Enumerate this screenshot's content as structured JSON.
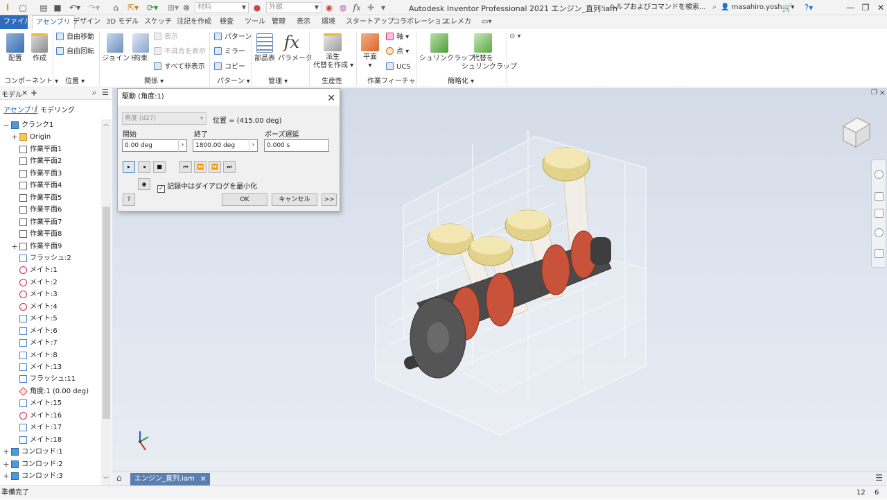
{
  "app": {
    "title": "Autodesk Inventor Professional 2021   エンジン_直列.iam",
    "material_placeholder": "材料",
    "appearance_placeholder": "外観",
    "help_search": "ヘルプおよびコマンドを検索...",
    "user": "masahiro.yosh..."
  },
  "tabs": [
    "ファイル",
    "アセンブリ",
    "デザイン",
    "3D モデル",
    "スケッチ",
    "注記を作成",
    "検査",
    "ツール",
    "管理",
    "表示",
    "環境",
    "スタートアップ",
    "コラボレーション",
    "エレメカ"
  ],
  "active_tab": "アセンブリ",
  "ribbon": {
    "component": {
      "place": "配置",
      "create": "作成",
      "group": "コンポーネント"
    },
    "position": {
      "free_move": "自由移動",
      "free_rotate": "自由回転",
      "group": "位置"
    },
    "relations": {
      "joint": "ジョイント",
      "constrain": "拘束",
      "show": "表示",
      "show_problem": "不具合を表示",
      "hide_all": "すべて非表示",
      "group": "関係"
    },
    "pattern": {
      "pattern": "パターン",
      "mirror": "ミラー",
      "copy": "コピー",
      "group": "パターン"
    },
    "manage": {
      "bom": "部品表",
      "params": "パラメータ",
      "group": "管理"
    },
    "productivity": {
      "derive_l1": "派生",
      "derive_l2": "代替を作成",
      "group": "生産性"
    },
    "work": {
      "plane": "平面",
      "axis": "軸",
      "point": "点",
      "ucs": "UCS",
      "group": "作業フィーチャ"
    },
    "simplify": {
      "shrinkwrap": "シュリンクラップ",
      "sub_l1": "代替を",
      "sub_l2": "シュリンクラップ",
      "group": "簡略化"
    }
  },
  "browser": {
    "title": "モデル",
    "tab_assembly": "アセンブリ",
    "tab_modeling": "モデリング",
    "items": [
      {
        "label": "クランク1",
        "level": 0,
        "expand": "−",
        "icon": "part"
      },
      {
        "label": "Origin",
        "level": 1,
        "expand": "+",
        "icon": "folder"
      },
      {
        "label": "作業平面1",
        "level": 1,
        "expand": "",
        "icon": "plane"
      },
      {
        "label": "作業平面2",
        "level": 1,
        "expand": "",
        "icon": "plane"
      },
      {
        "label": "作業平面3",
        "level": 1,
        "expand": "",
        "icon": "plane"
      },
      {
        "label": "作業平面4",
        "level": 1,
        "expand": "",
        "icon": "plane"
      },
      {
        "label": "作業平面5",
        "level": 1,
        "expand": "",
        "icon": "plane"
      },
      {
        "label": "作業平面6",
        "level": 1,
        "expand": "",
        "icon": "plane"
      },
      {
        "label": "作業平面7",
        "level": 1,
        "expand": "",
        "icon": "plane"
      },
      {
        "label": "作業平面8",
        "level": 1,
        "expand": "",
        "icon": "plane"
      },
      {
        "label": "作業平面9",
        "level": 1,
        "expand": "+",
        "icon": "plane"
      },
      {
        "label": "フラッシュ:2",
        "level": 1,
        "expand": "",
        "icon": "flush"
      },
      {
        "label": "メイト:1",
        "level": 1,
        "expand": "",
        "icon": "mate"
      },
      {
        "label": "メイト:2",
        "level": 1,
        "expand": "",
        "icon": "mate"
      },
      {
        "label": "メイト:3",
        "level": 1,
        "expand": "",
        "icon": "mate"
      },
      {
        "label": "メイト:4",
        "level": 1,
        "expand": "",
        "icon": "mate"
      },
      {
        "label": "メイト:5",
        "level": 1,
        "expand": "",
        "icon": "flush"
      },
      {
        "label": "メイト:6",
        "level": 1,
        "expand": "",
        "icon": "flush"
      },
      {
        "label": "メイト:7",
        "level": 1,
        "expand": "",
        "icon": "flush"
      },
      {
        "label": "メイト:8",
        "level": 1,
        "expand": "",
        "icon": "flush"
      },
      {
        "label": "メイト:13",
        "level": 1,
        "expand": "",
        "icon": "flush"
      },
      {
        "label": "フラッシュ:11",
        "level": 1,
        "expand": "",
        "icon": "flush"
      },
      {
        "label": "角度:1 (0.00 deg)",
        "level": 1,
        "expand": "",
        "icon": "angle"
      },
      {
        "label": "メイト:15",
        "level": 1,
        "expand": "",
        "icon": "flush"
      },
      {
        "label": "メイト:16",
        "level": 1,
        "expand": "",
        "icon": "mate"
      },
      {
        "label": "メイト:17",
        "level": 1,
        "expand": "",
        "icon": "flush"
      },
      {
        "label": "メイト:18",
        "level": 1,
        "expand": "",
        "icon": "flush"
      },
      {
        "label": "コンロッド:1",
        "level": 0,
        "expand": "+",
        "icon": "part"
      },
      {
        "label": "コンロッド:2",
        "level": 0,
        "expand": "+",
        "icon": "part"
      },
      {
        "label": "コンロッド:3",
        "level": 0,
        "expand": "+",
        "icon": "part"
      }
    ]
  },
  "dialog": {
    "title": "駆動 (角度:1)",
    "constraint_select": "角度 (d27)",
    "position_text": "位置 = (415.00 deg)",
    "start_label": "開始",
    "end_label": "終了",
    "pause_label": "ポーズ遅延",
    "start_value": "0.00 deg",
    "end_value": "1800.00 deg",
    "pause_value": "0.000 s",
    "record_minimize": "記録中はダイアログを最小化",
    "record_checked": true,
    "ok": "OK",
    "cancel": "キャンセル",
    "more": ">>",
    "help": "?"
  },
  "document_tab": "エンジン_直列.iam",
  "status": {
    "text": "準備完了",
    "count1": "12",
    "count2": "6"
  },
  "colors": {
    "accent": "#2f6dbb",
    "piston": "#e2d28a",
    "gear": "#c8533a",
    "dark_metal": "#4a4a4a"
  }
}
